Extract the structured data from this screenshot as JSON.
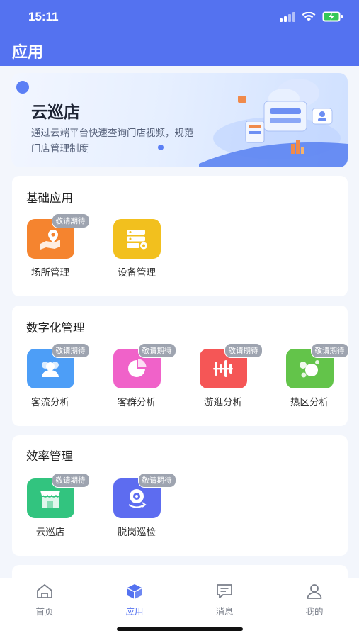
{
  "status_bar": {
    "time": "15:11"
  },
  "nav": {
    "title": "应用"
  },
  "banner": {
    "title": "云巡店",
    "description": "通过云端平台快速查询门店视频，规范门店管理制度"
  },
  "sections": [
    {
      "title": "基础应用",
      "apps": [
        {
          "label": "场所管理",
          "badge": "敬请期待",
          "color": "#f5842f",
          "icon": "location-map-icon"
        },
        {
          "label": "设备管理",
          "badge": "",
          "color": "#f2c01e",
          "icon": "server-icon"
        }
      ]
    },
    {
      "title": "数字化管理",
      "apps": [
        {
          "label": "客流分析",
          "badge": "敬请期待",
          "color": "#4d9ef7",
          "icon": "users-icon"
        },
        {
          "label": "客群分析",
          "badge": "敬请期待",
          "color": "#f062c9",
          "icon": "pie-chart-icon"
        },
        {
          "label": "游逛分析",
          "badge": "敬请期待",
          "color": "#f55656",
          "icon": "equalizer-icon"
        },
        {
          "label": "热区分析",
          "badge": "敬请期待",
          "color": "#63c44a",
          "icon": "bubbles-icon"
        }
      ]
    },
    {
      "title": "效率管理",
      "apps": [
        {
          "label": "云巡店",
          "badge": "敬请期待",
          "color": "#32c47f",
          "icon": "store-icon"
        },
        {
          "label": "脱岗巡检",
          "badge": "敬请期待",
          "color": "#5d6cf0",
          "icon": "camera-rotate-icon"
        }
      ]
    }
  ],
  "tabs": [
    {
      "label": "首页",
      "icon": "home-icon",
      "active": false
    },
    {
      "label": "应用",
      "icon": "cube-icon",
      "active": true
    },
    {
      "label": "消息",
      "icon": "message-icon",
      "active": false
    },
    {
      "label": "我的",
      "icon": "user-icon",
      "active": false
    }
  ],
  "colors": {
    "primary": "#5472f0",
    "badge": "#9ea4b0",
    "background": "#f3f6fc"
  }
}
